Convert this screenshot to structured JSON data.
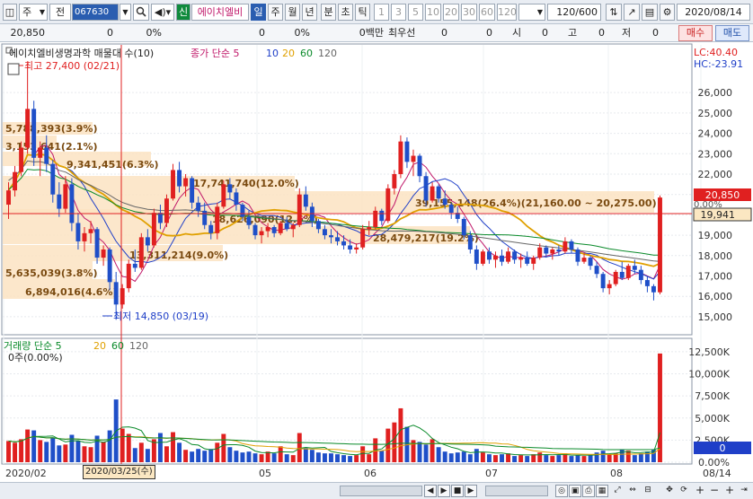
{
  "toolbar": {
    "market": "주",
    "prev": "전",
    "code": "067630",
    "tag": "신",
    "stock_name": "에이치엘비",
    "periods": [
      "일",
      "주",
      "월",
      "년",
      "분",
      "초",
      "틱"
    ],
    "minutes": [
      "1",
      "3",
      "5",
      "10",
      "20",
      "30",
      "60",
      "120"
    ],
    "range": "120/600",
    "date": "2020/08/14"
  },
  "quote": {
    "price": "20,850",
    "change": "0",
    "rate1": "0%",
    "v1": "0",
    "rate2": "0%",
    "volume_label": "0백만",
    "best_bid_label": "최우선",
    "bid1": "0",
    "bid2": "0",
    "open_label": "시",
    "open": "0",
    "high_label": "고",
    "high": "0",
    "low_label": "저",
    "low": "0",
    "buy": "매수",
    "sell": "매도"
  },
  "price_panel": {
    "title": "에이치엘비생명과학 매물대 수(10)",
    "ma_label": "종가 단순 5",
    "ma_periods": [
      "10",
      "20",
      "60",
      "120"
    ],
    "ma_colors": [
      "#c0186a",
      "#1f3fc8",
      "#e0a000",
      "#0a8a2a",
      "#666666"
    ],
    "lc": "LC:40.40",
    "hc": "HC:-23.91",
    "high_note": "최고 27,400 (02/21)",
    "low_note": "최저 14,850 (03/19)",
    "current_price": "20,850",
    "cross_price": "19,941",
    "zero_pct": "0.00%",
    "cursor_date": "2020/03/25(수)",
    "profile": [
      {
        "label": "5,788,393(3.9%)"
      },
      {
        "label": "3,153,641(2.1%)"
      },
      {
        "label": "9,341,451(6.3%)"
      },
      {
        "label": "17,741,740(12.0%)"
      },
      {
        "label": "39,155,148(26.4%)(21,160.00 ~ 20,275.00)"
      },
      {
        "label": "18,626,090(12.6%)"
      },
      {
        "label": "28,479,217(19.2%)"
      },
      {
        "label": "13,311,214(9.0%)"
      },
      {
        "label": "5,635,039(3.8%)"
      },
      {
        "label": "6,894,016(4.6%)"
      }
    ],
    "y_ticks": [
      "26,000",
      "25,000",
      "24,000",
      "23,000",
      "22,000",
      "21,000",
      "20,000",
      "19,000",
      "18,000",
      "17,000",
      "16,000",
      "15,000"
    ],
    "x_ticks": [
      "2020/02",
      "05",
      "06",
      "07",
      "08",
      "08/14"
    ]
  },
  "volume_panel": {
    "title": "거래량 단순 5",
    "ma_periods": [
      "20",
      "60",
      "120"
    ],
    "zero_label": "0주(0.00%)",
    "y_ticks": [
      "12,500K",
      "10,000K",
      "7,500K",
      "5,000K",
      "2,500K",
      "0.00%"
    ],
    "current": "0"
  },
  "chart_data": {
    "type": "candlestick",
    "price_range": [
      14600,
      26800
    ],
    "volume_max": 13000,
    "candles": [
      [
        20500,
        21600,
        19800,
        21200
      ],
      [
        21200,
        22400,
        20900,
        22100
      ],
      [
        22100,
        23600,
        21900,
        23300
      ],
      [
        23300,
        27400,
        23000,
        25200
      ],
      [
        25200,
        25600,
        22400,
        22800
      ],
      [
        22800,
        23600,
        21900,
        23300
      ],
      [
        23300,
        23900,
        22100,
        22500
      ],
      [
        22500,
        22700,
        20600,
        21000
      ],
      [
        21000,
        21600,
        19900,
        20300
      ],
      [
        20300,
        21900,
        20100,
        21500
      ],
      [
        21500,
        21800,
        19200,
        19600
      ],
      [
        19600,
        20100,
        18300,
        18700
      ],
      [
        18700,
        19400,
        18200,
        19100
      ],
      [
        19100,
        19700,
        18600,
        19300
      ],
      [
        19300,
        19400,
        17600,
        17900
      ],
      [
        17900,
        18500,
        17500,
        18300
      ],
      [
        18300,
        18400,
        16300,
        16700
      ],
      [
        16700,
        17200,
        14850,
        15600
      ],
      [
        15600,
        16600,
        15400,
        16400
      ],
      [
        16400,
        17800,
        16200,
        17600
      ],
      [
        17600,
        18300,
        17200,
        17400
      ],
      [
        17400,
        19100,
        17300,
        18900
      ],
      [
        18900,
        19300,
        18200,
        18500
      ],
      [
        18500,
        20300,
        18400,
        20100
      ],
      [
        20100,
        20500,
        19300,
        19600
      ],
      [
        19600,
        21000,
        19400,
        20800
      ],
      [
        20800,
        22500,
        20700,
        22200
      ],
      [
        22200,
        22600,
        21100,
        21400
      ],
      [
        21400,
        22000,
        20900,
        21800
      ],
      [
        21800,
        21900,
        20300,
        20600
      ],
      [
        20600,
        20900,
        19900,
        20200
      ],
      [
        20200,
        20600,
        19300,
        19500
      ],
      [
        19500,
        19700,
        18800,
        19100
      ],
      [
        19100,
        20600,
        18800,
        20400
      ],
      [
        20400,
        21700,
        20300,
        21500
      ],
      [
        21500,
        21800,
        20800,
        21100
      ],
      [
        21100,
        21300,
        20200,
        20500
      ],
      [
        20500,
        20600,
        19700,
        19900
      ],
      [
        19900,
        20200,
        19300,
        19500
      ],
      [
        19500,
        19600,
        18800,
        19000
      ],
      [
        19000,
        19400,
        18600,
        19200
      ],
      [
        19200,
        19600,
        18900,
        19400
      ],
      [
        19400,
        19500,
        18900,
        19100
      ],
      [
        19100,
        19700,
        19000,
        19600
      ],
      [
        19600,
        19900,
        19200,
        19300
      ],
      [
        19300,
        19600,
        18900,
        19500
      ],
      [
        19500,
        21300,
        19400,
        21000
      ],
      [
        21000,
        21400,
        20200,
        20400
      ],
      [
        20400,
        20600,
        19400,
        19700
      ],
      [
        19700,
        19800,
        19100,
        19300
      ],
      [
        19300,
        19500,
        18800,
        19000
      ],
      [
        19000,
        19300,
        18600,
        18900
      ],
      [
        18900,
        19200,
        18500,
        18700
      ],
      [
        18700,
        19000,
        18300,
        18500
      ],
      [
        18500,
        18800,
        18100,
        18300
      ],
      [
        18300,
        18600,
        18100,
        18400
      ],
      [
        18400,
        19500,
        18300,
        19300
      ],
      [
        19300,
        19700,
        19000,
        19400
      ],
      [
        19400,
        20400,
        19300,
        20200
      ],
      [
        20200,
        20300,
        19500,
        19700
      ],
      [
        19700,
        21500,
        19600,
        21300
      ],
      [
        21300,
        22200,
        21000,
        22000
      ],
      [
        22000,
        23900,
        21800,
        23600
      ],
      [
        23600,
        23800,
        22300,
        22600
      ],
      [
        22600,
        23200,
        21900,
        22900
      ],
      [
        22900,
        23000,
        21600,
        21900
      ],
      [
        21900,
        22100,
        20400,
        20700
      ],
      [
        20700,
        21600,
        20600,
        21400
      ],
      [
        21400,
        21500,
        20600,
        20800
      ],
      [
        20800,
        21200,
        20300,
        20500
      ],
      [
        20500,
        20600,
        19800,
        20100
      ],
      [
        20100,
        20400,
        19600,
        19800
      ],
      [
        19800,
        19900,
        18800,
        19000
      ],
      [
        19000,
        19200,
        18100,
        18300
      ],
      [
        18300,
        18500,
        17300,
        17600
      ],
      [
        17600,
        18300,
        17500,
        18200
      ],
      [
        18200,
        18400,
        17600,
        17800
      ],
      [
        17800,
        18200,
        17400,
        18000
      ],
      [
        18000,
        18300,
        17500,
        17700
      ],
      [
        17700,
        18400,
        17600,
        18200
      ],
      [
        18200,
        18300,
        17600,
        17800
      ],
      [
        17800,
        18100,
        17400,
        17900
      ],
      [
        17900,
        18200,
        17500,
        17600
      ],
      [
        17600,
        18000,
        17300,
        17900
      ],
      [
        17900,
        18600,
        17800,
        18400
      ],
      [
        18400,
        18500,
        17900,
        18100
      ],
      [
        18100,
        18400,
        17800,
        18300
      ],
      [
        18300,
        18500,
        18000,
        18200
      ],
      [
        18200,
        18900,
        18100,
        18700
      ],
      [
        18700,
        18800,
        18100,
        18300
      ],
      [
        18300,
        18400,
        17500,
        17700
      ],
      [
        17700,
        18100,
        17600,
        17900
      ],
      [
        17900,
        18000,
        17300,
        17500
      ],
      [
        17500,
        17700,
        16900,
        17100
      ],
      [
        17100,
        17200,
        16200,
        16400
      ],
      [
        16400,
        16800,
        16100,
        16600
      ],
      [
        16600,
        17300,
        16500,
        17200
      ],
      [
        17200,
        17700,
        16800,
        16900
      ],
      [
        16900,
        17600,
        16800,
        17500
      ],
      [
        17500,
        17800,
        17100,
        17300
      ],
      [
        17300,
        17500,
        16600,
        16800
      ],
      [
        16800,
        17000,
        16200,
        16500
      ],
      [
        16500,
        16600,
        15800,
        16200
      ],
      [
        16200,
        20950,
        16100,
        20850
      ]
    ],
    "volumes": [
      2400,
      2200,
      2600,
      3700,
      3600,
      2500,
      2300,
      2800,
      1900,
      2000,
      3100,
      2400,
      1800,
      1700,
      3000,
      2300,
      3600,
      7100,
      3800,
      3200,
      1600,
      2200,
      1500,
      2600,
      3300,
      1800,
      3400,
      2200,
      1400,
      1200,
      1500,
      1300,
      1500,
      2200,
      3200,
      1700,
      1300,
      1100,
      1200,
      1000,
      900,
      1200,
      1000,
      1800,
      900,
      800,
      3300,
      1600,
      1400,
      1100,
      1000,
      1000,
      900,
      800,
      700,
      800,
      1800,
      900,
      2700,
      1300,
      3800,
      4500,
      6100,
      4000,
      2500,
      2300,
      2000,
      2600,
      1700,
      1200,
      1000,
      1100,
      1200,
      900,
      1500,
      1100,
      900,
      800,
      900,
      1000,
      700,
      800,
      700,
      900,
      1100,
      800,
      700,
      800,
      1000,
      700,
      800,
      700,
      800,
      1100,
      1300,
      900,
      1000,
      1400,
      1300,
      800,
      1000,
      1200,
      1400,
      12300
    ]
  }
}
